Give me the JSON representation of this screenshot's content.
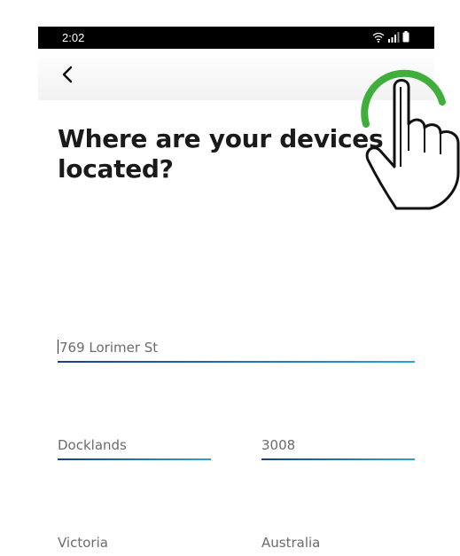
{
  "status_bar": {
    "time": "2:02",
    "icons": [
      "wifi-icon",
      "signal-icon",
      "battery-icon"
    ]
  },
  "app_bar": {
    "back_icon": "chevron-left-icon"
  },
  "title": {
    "line1": "Where are your devices",
    "line2": "located?"
  },
  "form": {
    "street": "769 Lorimer St",
    "suburb": "Docklands",
    "postcode": "3008",
    "state": "Victoria",
    "country": "Australia"
  },
  "colors": {
    "accent_start": "#1b3f8c",
    "accent_end": "#2aa2d8",
    "tap_ring": "#3fae3a",
    "status_bar": "#000000"
  }
}
